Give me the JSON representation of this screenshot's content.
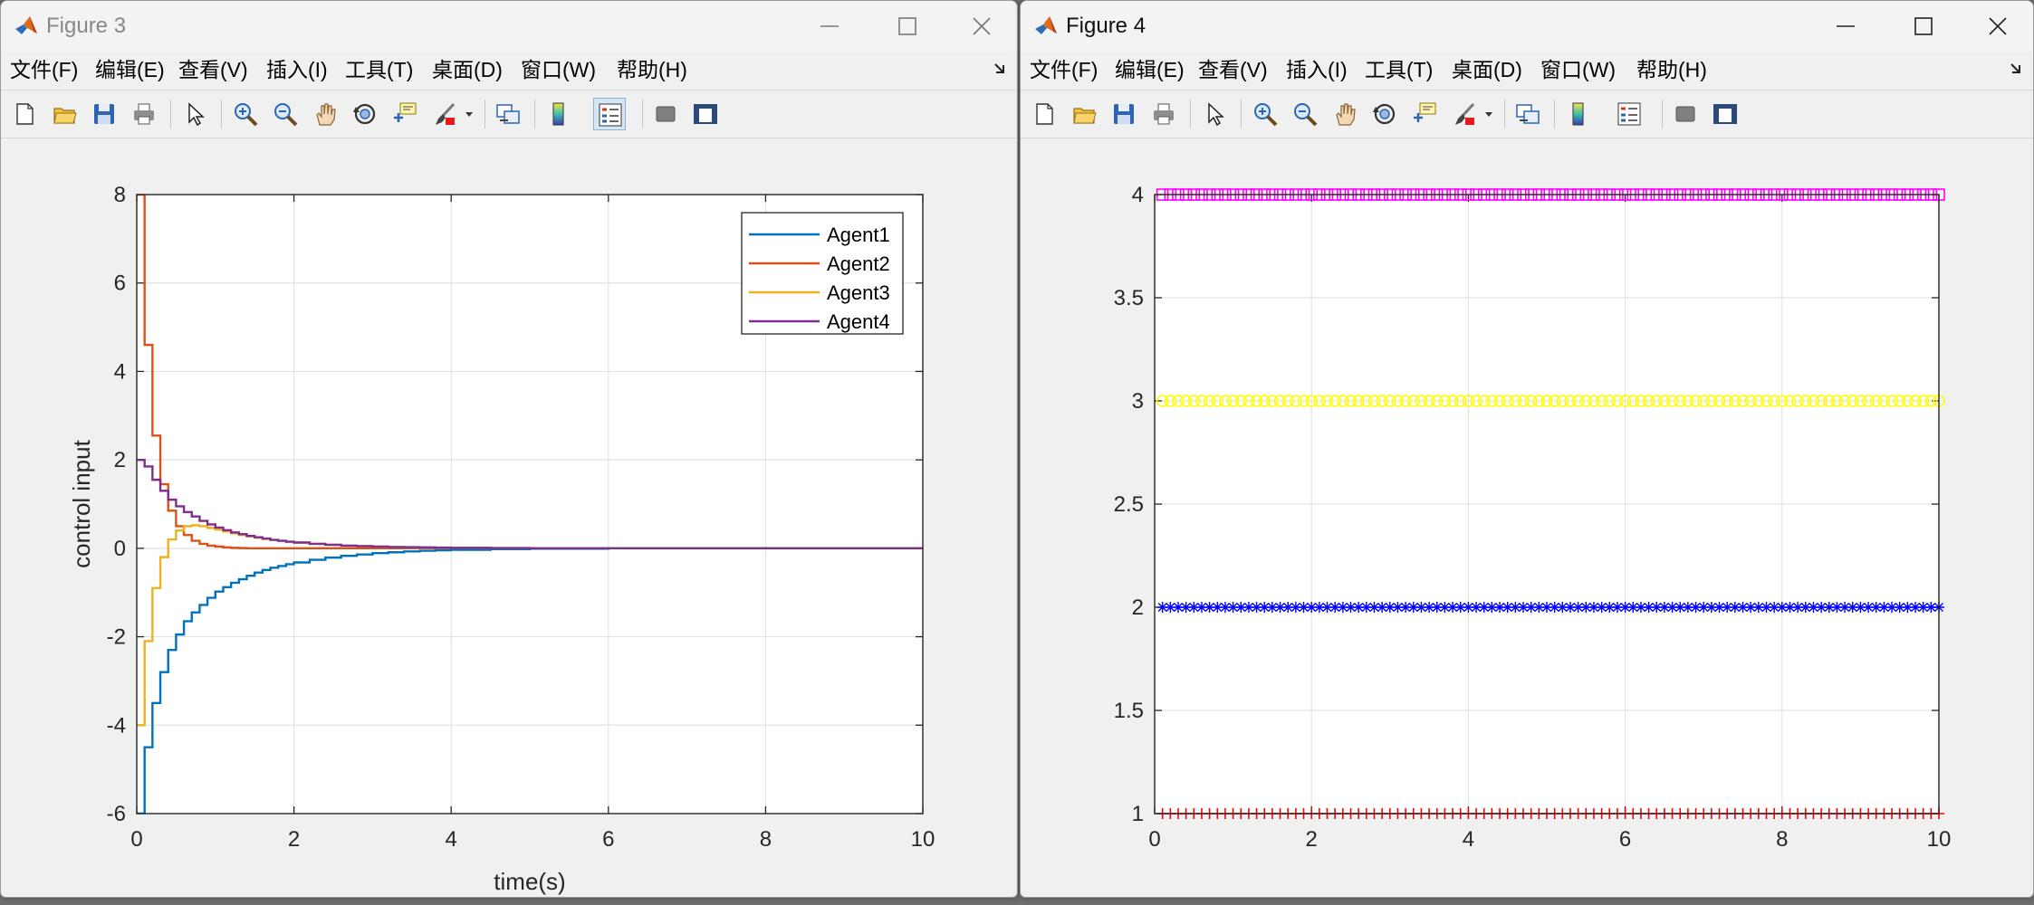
{
  "figure3": {
    "title": "Figure 3",
    "menu": [
      "文件(F)",
      "编辑(E)",
      "查看(V)",
      "插入(I)",
      "工具(T)",
      "桌面(D)",
      "窗口(W)",
      "帮助(H)"
    ],
    "toolbar_icons": [
      "new-figure-icon",
      "open-file-icon",
      "save-icon",
      "print-icon",
      "pointer-icon",
      "zoom-in-icon",
      "zoom-out-icon",
      "pan-hand-icon",
      "rotate-3d-icon",
      "data-cursor-icon",
      "brush-icon",
      "brush-dropdown-icon",
      "link-plot-icon",
      "colorbar-icon",
      "legend-icon",
      "hide-plot-tools-icon",
      "show-plot-tools-icon"
    ]
  },
  "figure4": {
    "title": "Figure 4",
    "menu": [
      "文件(F)",
      "编辑(E)",
      "查看(V)",
      "插入(I)",
      "工具(T)",
      "桌面(D)",
      "窗口(W)",
      "帮助(H)"
    ],
    "toolbar_icons": [
      "new-figure-icon",
      "open-file-icon",
      "save-icon",
      "print-icon",
      "pointer-icon",
      "zoom-in-icon",
      "zoom-out-icon",
      "pan-hand-icon",
      "rotate-3d-icon",
      "data-cursor-icon",
      "brush-icon",
      "brush-dropdown-icon",
      "link-plot-icon",
      "colorbar-icon",
      "legend-icon",
      "hide-plot-tools-icon",
      "show-plot-tools-icon"
    ]
  },
  "chart_data": [
    {
      "type": "line",
      "style": "stairs",
      "title": "",
      "xlabel": "time(s)",
      "ylabel": "control input",
      "xlim": [
        0,
        10
      ],
      "ylim": [
        -6,
        8
      ],
      "xticks": [
        0,
        2,
        4,
        6,
        8,
        10
      ],
      "yticks": [
        -6,
        -4,
        -2,
        0,
        2,
        4,
        6,
        8
      ],
      "grid": true,
      "legend_position": "top-right",
      "x": [
        0,
        0.1,
        0.2,
        0.3,
        0.4,
        0.5,
        0.6,
        0.7,
        0.8,
        0.9,
        1.0,
        1.1,
        1.2,
        1.3,
        1.4,
        1.5,
        1.6,
        1.7,
        1.8,
        1.9,
        2.0,
        2.2,
        2.4,
        2.6,
        2.8,
        3.0,
        3.2,
        3.4,
        3.6,
        3.8,
        4.0,
        4.5,
        5.0,
        6.0,
        10.0
      ],
      "series": [
        {
          "name": "Agent1",
          "color": "#0072BD",
          "values": [
            -6,
            -4.5,
            -3.5,
            -2.8,
            -2.3,
            -1.95,
            -1.65,
            -1.45,
            -1.28,
            -1.12,
            -0.98,
            -0.88,
            -0.78,
            -0.7,
            -0.62,
            -0.55,
            -0.49,
            -0.44,
            -0.4,
            -0.36,
            -0.32,
            -0.26,
            -0.21,
            -0.17,
            -0.14,
            -0.11,
            -0.09,
            -0.07,
            -0.055,
            -0.045,
            -0.035,
            -0.02,
            -0.01,
            0,
            0
          ]
        },
        {
          "name": "Agent2",
          "color": "#D95319",
          "values": [
            8,
            4.6,
            2.55,
            1.45,
            0.85,
            0.5,
            0.3,
            0.17,
            0.1,
            0.06,
            0.04,
            0.02,
            0.01,
            0.005,
            0,
            0,
            0,
            0,
            0,
            0,
            0,
            0,
            0,
            0,
            0,
            0,
            0,
            0,
            0,
            0,
            0,
            0,
            0,
            0,
            0
          ]
        },
        {
          "name": "Agent3",
          "color": "#EDB120",
          "values": [
            -4,
            -2.1,
            -0.9,
            -0.2,
            0.2,
            0.4,
            0.5,
            0.52,
            0.5,
            0.46,
            0.42,
            0.38,
            0.34,
            0.3,
            0.27,
            0.24,
            0.21,
            0.19,
            0.17,
            0.15,
            0.13,
            0.1,
            0.08,
            0.06,
            0.05,
            0.04,
            0.03,
            0.02,
            0.015,
            0.01,
            0.01,
            0.005,
            0,
            0,
            0
          ]
        },
        {
          "name": "Agent4",
          "color": "#7E2F8E",
          "values": [
            2,
            1.85,
            1.55,
            1.3,
            1.1,
            0.95,
            0.82,
            0.72,
            0.62,
            0.54,
            0.47,
            0.41,
            0.36,
            0.32,
            0.28,
            0.25,
            0.22,
            0.19,
            0.17,
            0.15,
            0.13,
            0.1,
            0.08,
            0.06,
            0.05,
            0.04,
            0.03,
            0.025,
            0.02,
            0.015,
            0.01,
            0.005,
            0,
            0,
            0
          ]
        }
      ]
    },
    {
      "type": "scatter",
      "title": "",
      "xlabel": "",
      "ylabel": "",
      "xlim": [
        0,
        10
      ],
      "ylim": [
        1,
        4
      ],
      "xticks": [
        0,
        2,
        4,
        6,
        8,
        10
      ],
      "yticks": [
        1,
        1.5,
        2,
        2.5,
        3,
        3.5,
        4
      ],
      "grid": true,
      "x_range": [
        0.1,
        10
      ],
      "x_step": 0.1,
      "series": [
        {
          "marker": "+",
          "color": "#ff0000",
          "value": 1
        },
        {
          "marker": "*",
          "color": "#0000ff",
          "value": 2
        },
        {
          "marker": "o",
          "color": "#ffff00",
          "value": 3
        },
        {
          "marker": "square",
          "color": "#ff00ff",
          "value": 4
        }
      ]
    }
  ]
}
